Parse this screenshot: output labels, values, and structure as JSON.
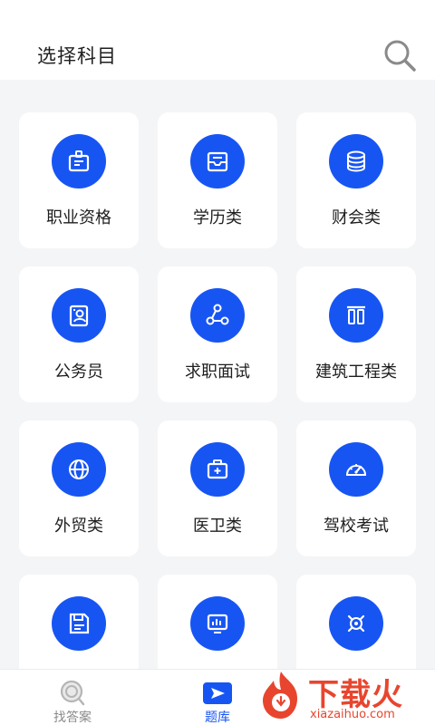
{
  "header": {
    "title": "选择科目",
    "search_icon": "search-icon"
  },
  "subjects": [
    {
      "label": "职业资格",
      "icon": "id-badge-icon"
    },
    {
      "label": "学历类",
      "icon": "inbox-tray-icon"
    },
    {
      "label": "财会类",
      "icon": "database-icon"
    },
    {
      "label": "公务员",
      "icon": "profile-card-icon"
    },
    {
      "label": "求职面试",
      "icon": "network-nodes-icon"
    },
    {
      "label": "建筑工程类",
      "icon": "pillars-icon"
    },
    {
      "label": "外贸类",
      "icon": "globe-icon"
    },
    {
      "label": "医卫类",
      "icon": "medical-kit-icon"
    },
    {
      "label": "驾校考试",
      "icon": "speedometer-icon"
    },
    {
      "label": "",
      "icon": "floppy-disk-icon"
    },
    {
      "label": "",
      "icon": "monitor-chart-icon"
    },
    {
      "label": "",
      "icon": "gear-target-icon"
    }
  ],
  "tabbar": {
    "items": [
      {
        "label": "找答案",
        "icon": "search-icon",
        "active": false
      },
      {
        "label": "题库",
        "icon": "play-flag-icon",
        "active": true
      }
    ]
  },
  "watermark": {
    "text": "下载火",
    "url": "xiazaihuo.com"
  },
  "colors": {
    "accent": "#1755f3",
    "background": "#f4f5f7",
    "card": "#ffffff",
    "watermark": "#e8452e"
  }
}
